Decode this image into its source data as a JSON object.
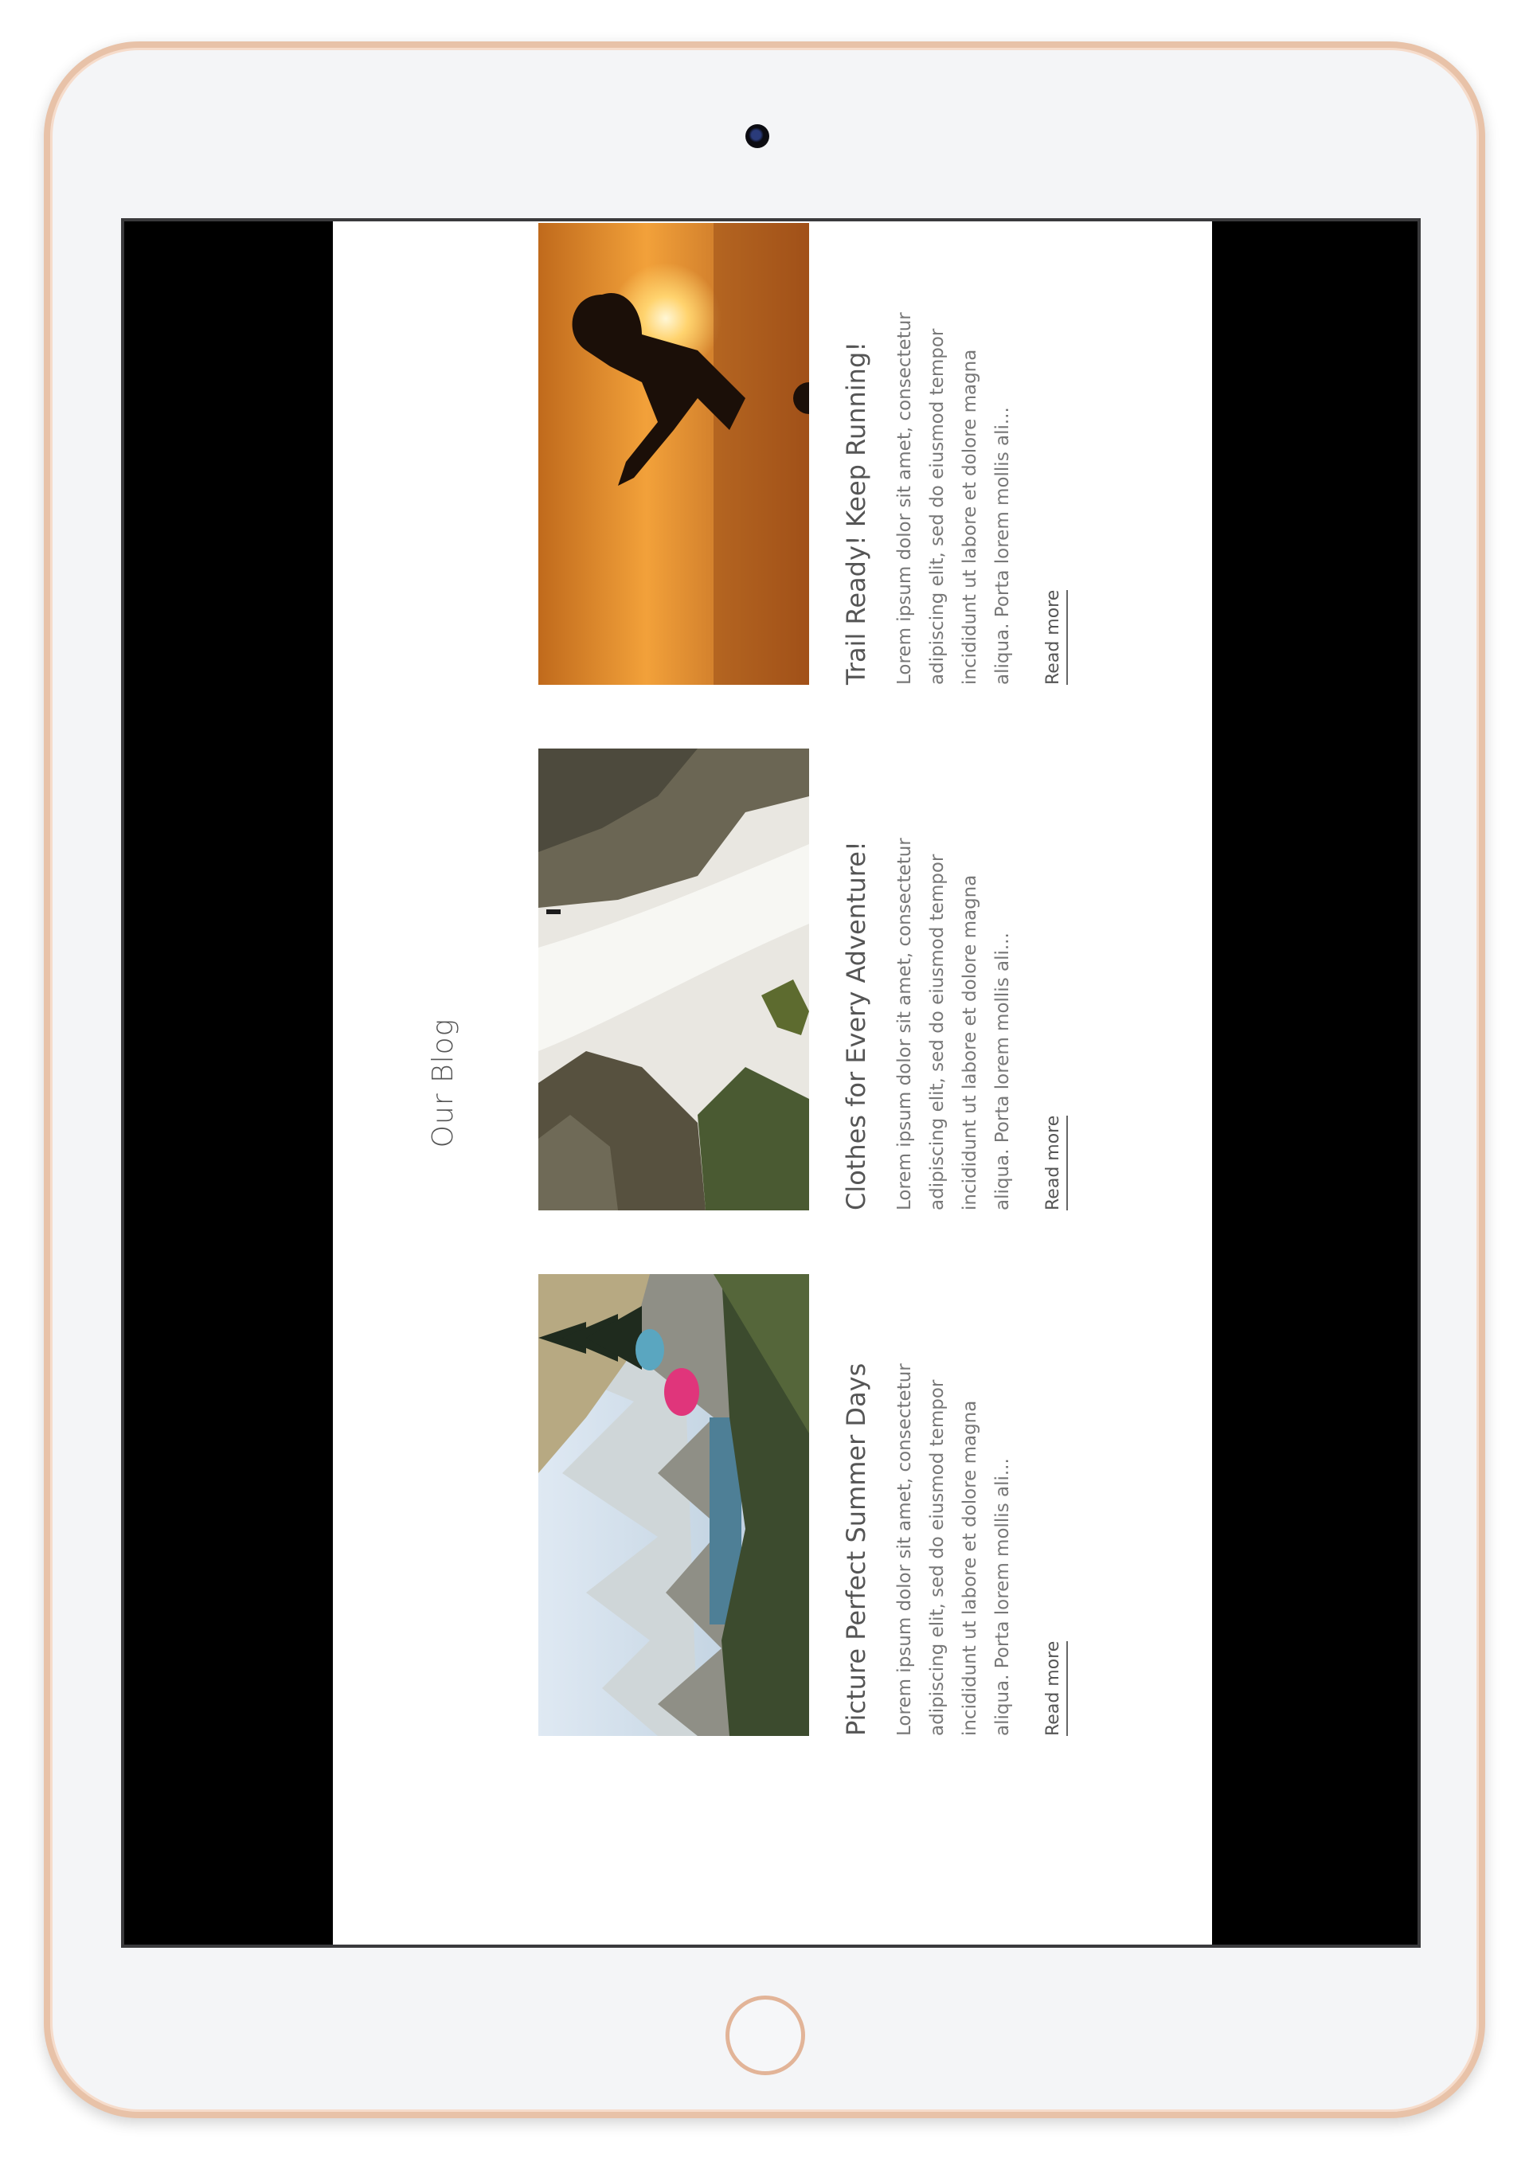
{
  "blog": {
    "title": "Our Blog",
    "posts": [
      {
        "title": "Picture Perfect Summer Days",
        "excerpt": "Lorem ipsum dolor sit amet, consectetur adipiscing elit, sed do eiusmod tempor incididunt ut labore et dolore magna aliqua. Porta lorem mollis ali...",
        "read_more": "Read more",
        "image": "mountain-lake-camping-photo"
      },
      {
        "title": "Clothes for Every Adventure!",
        "excerpt": "Lorem ipsum dolor sit amet, consectetur adipiscing elit, sed do eiusmod tempor incididunt ut labore et dolore magna aliqua. Porta lorem mollis ali...",
        "read_more": "Read more",
        "image": "waterfall-rocks-hiker-photo"
      },
      {
        "title": "Trail Ready! Keep Running!",
        "excerpt": "Lorem ipsum dolor sit amet, consectetur adipiscing elit, sed do eiusmod tempor incididunt ut labore et dolore magna aliqua. Porta lorem mollis ali...",
        "read_more": "Read more",
        "image": "sunset-runner-silhouette-photo"
      }
    ]
  },
  "colors": {
    "device_frame": "#e8c2a8",
    "screen_bezel": "#000000",
    "page_background": "#ffffff",
    "text": "#555555"
  }
}
